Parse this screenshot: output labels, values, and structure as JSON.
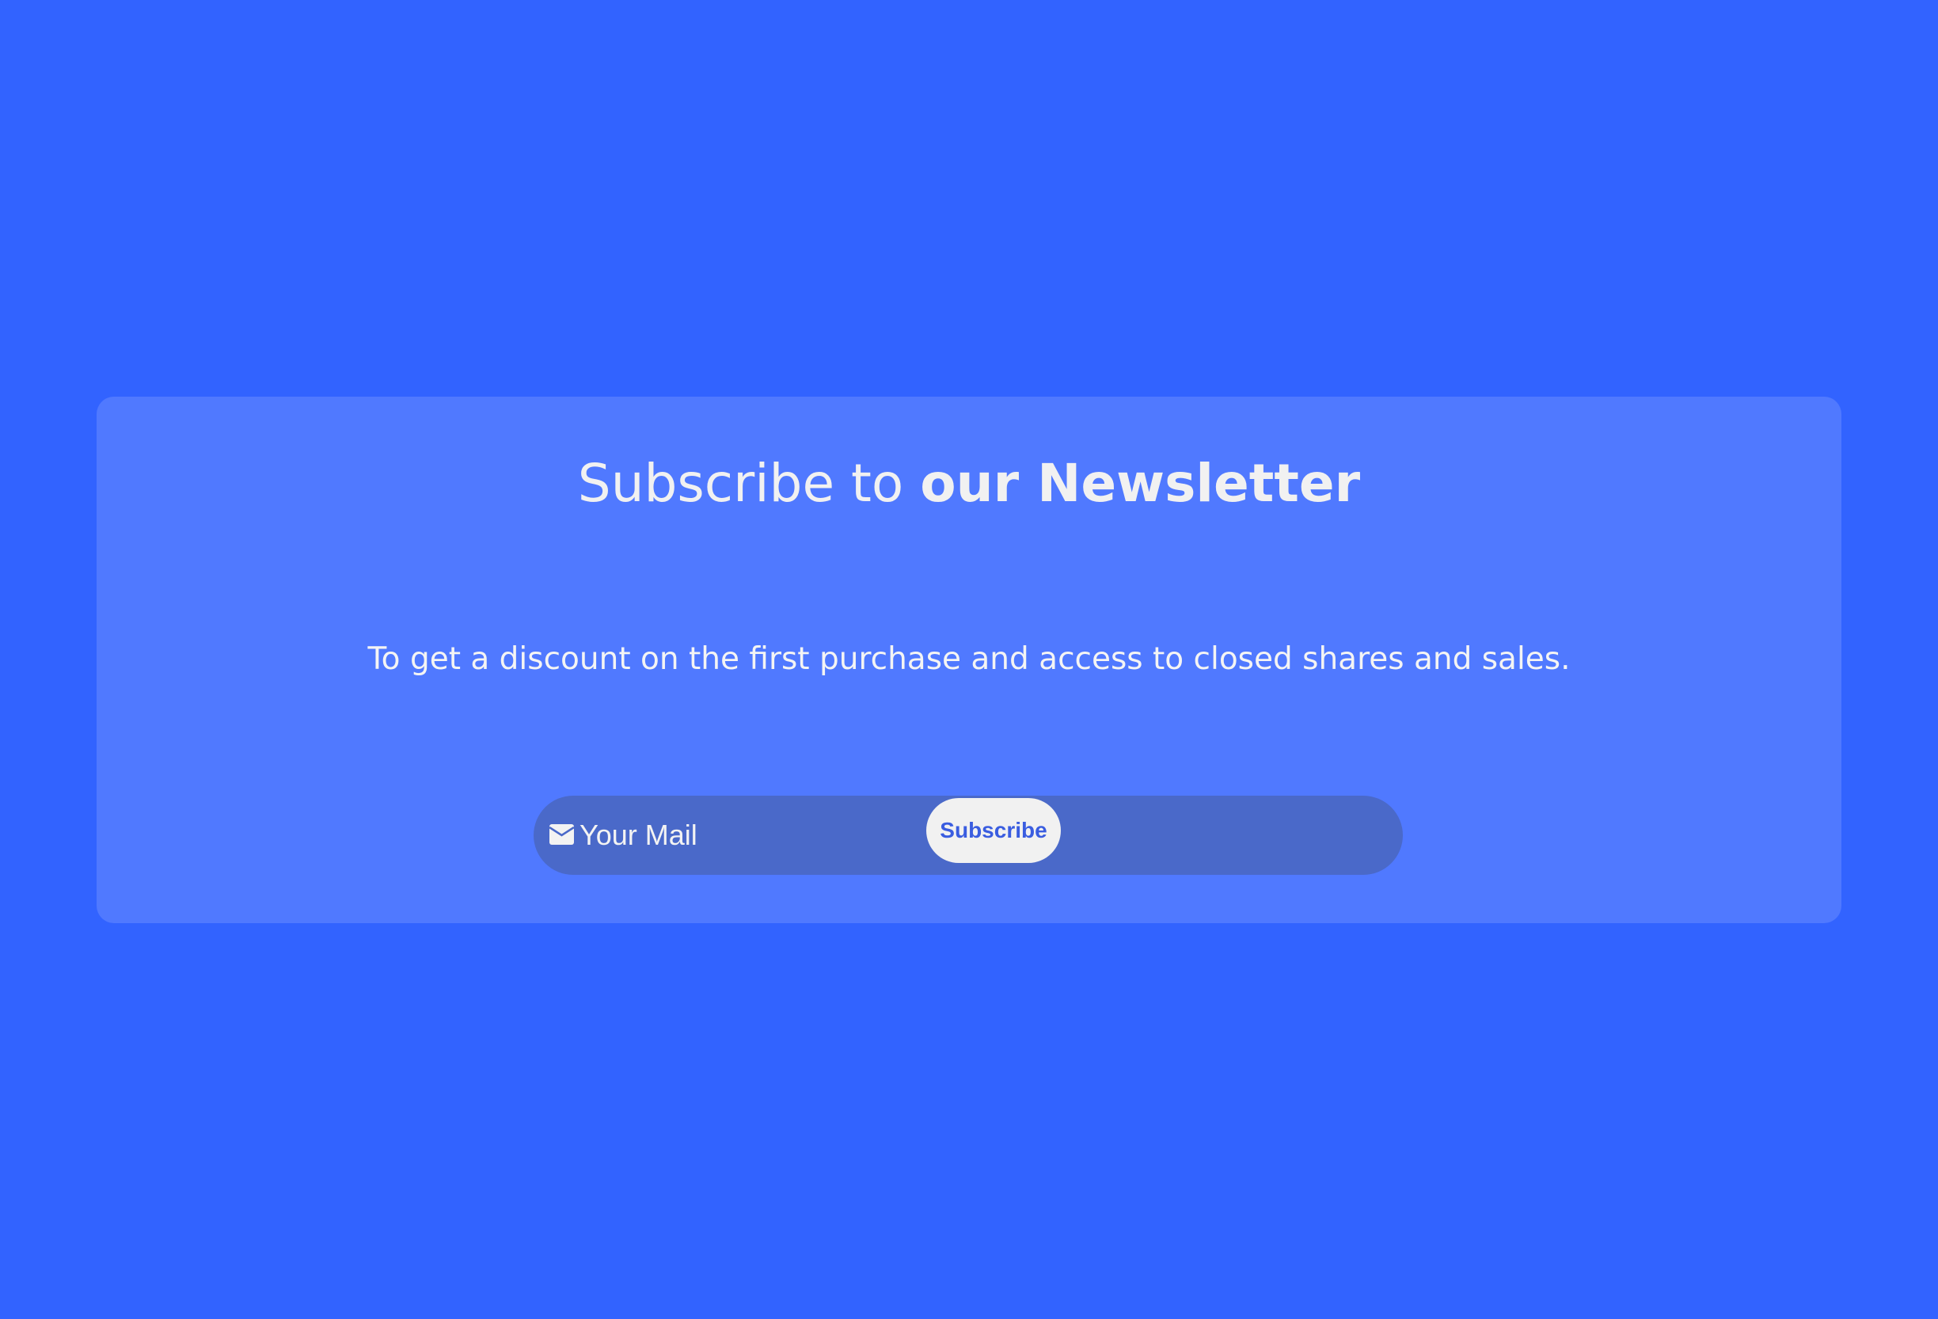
{
  "newsletter": {
    "title_light": "Subscribe to ",
    "title_bold": "our Newsletter",
    "description": "To get a discount on the first purchase and access to closed shares and sales.",
    "email_placeholder": "Your Mail",
    "email_value": "",
    "subscribe_label": "Subscribe",
    "icon": "envelope-icon"
  },
  "colors": {
    "page_background": "#3263ff",
    "card_background": "#5079ff",
    "form_background": "#4a69c9",
    "button_background": "#f1f1f1",
    "button_text": "#3a5de0",
    "text": "#f1f1f1"
  }
}
